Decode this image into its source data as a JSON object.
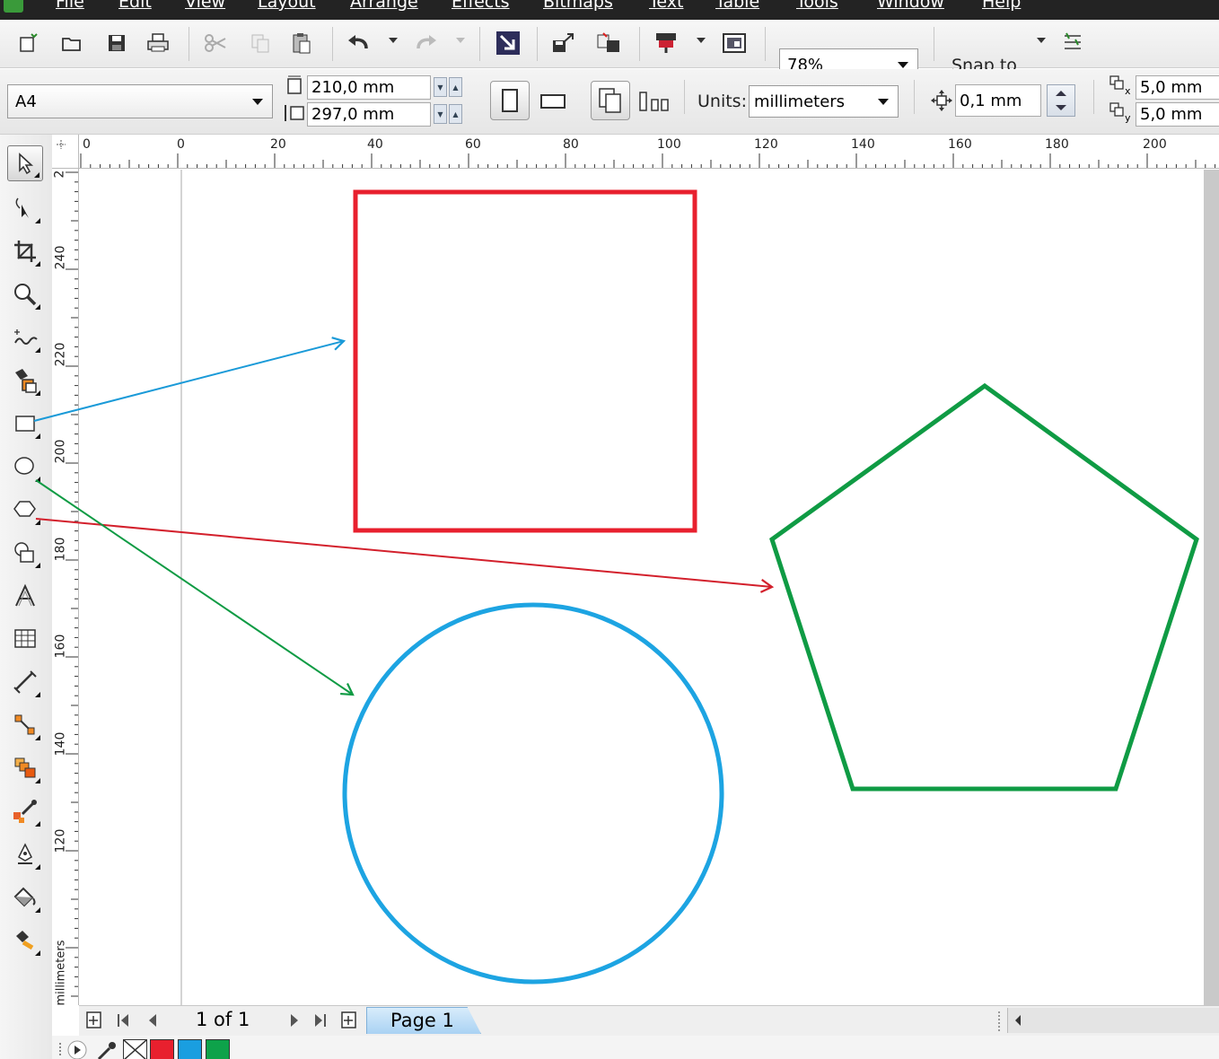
{
  "menu": {
    "items": [
      "File",
      "Edit",
      "View",
      "Layout",
      "Arrange",
      "Effects",
      "Bitmaps",
      "Text",
      "Table",
      "Tools",
      "Window",
      "Help"
    ]
  },
  "toolbar": {
    "zoom_value": "78%",
    "snap_label": "Snap to"
  },
  "property_bar": {
    "page_size": "A4",
    "page_width": "210,0 mm",
    "page_height": "297,0 mm",
    "units_label": "Units:",
    "units_value": "millimeters",
    "nudge_value": "0,1 mm",
    "dup_x": "5,0 mm",
    "dup_y": "5,0 mm"
  },
  "rulers": {
    "horizontal_ticks": [
      "0",
      "0",
      "20",
      "40",
      "60",
      "80",
      "100",
      "120",
      "140",
      "160",
      "180",
      "200"
    ],
    "vertical_ticks": [
      "2",
      "240",
      "220",
      "200",
      "180",
      "160",
      "140",
      "120"
    ],
    "vertical_unit": "millimeters"
  },
  "page_nav": {
    "page_counter": "1 of 1",
    "page_tab": "Page 1"
  },
  "palette": {
    "colors": [
      "#e8202e",
      "#1a9ee0",
      "#0ea24a"
    ]
  },
  "shapes": {
    "rectangle_color": "#e8202e",
    "ellipse_color": "#1da4e2",
    "polygon_color": "#0f9b44"
  }
}
